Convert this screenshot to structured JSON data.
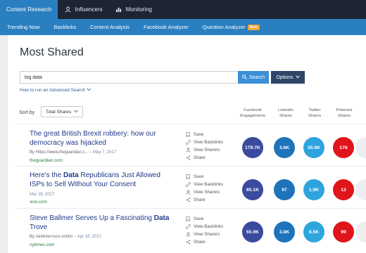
{
  "topnav": [
    {
      "label": "Content Research",
      "icon": "search-icon",
      "active": true
    },
    {
      "label": "Influencers",
      "icon": "user-icon",
      "active": false
    },
    {
      "label": "Monitoring",
      "icon": "bar-chart-icon",
      "active": false
    }
  ],
  "subnav": [
    {
      "label": "Trending Now"
    },
    {
      "label": "Backlinks"
    },
    {
      "label": "Content Analysis"
    },
    {
      "label": "Facebook Analyzer"
    },
    {
      "label": "Question Analyzer",
      "badge": "New"
    }
  ],
  "page_title": "Most Shared",
  "search": {
    "value": "big data",
    "button_label": "Search",
    "options_label": "Options"
  },
  "advanced_search_link": "How to run an Advanced Search",
  "sort": {
    "label": "Sort by",
    "selected": "Total Shares"
  },
  "columns": [
    {
      "line1": "Facebook",
      "line2": "Engagements"
    },
    {
      "line1": "LinkedIn",
      "line2": "Shares"
    },
    {
      "line1": "Twitter",
      "line2": "Shares"
    },
    {
      "line1": "Pinterest",
      "line2": "Shares"
    }
  ],
  "actions": [
    "Save",
    "View Backlinks",
    "View Sharers",
    "Share"
  ],
  "articles": [
    {
      "title_line1": "The great British Brexit robbery: how our",
      "title_line2": "democracy was hijacked",
      "author": "By Https://www.theguardian.c...",
      "date": "May 7, 2017",
      "domain": "theguardian.com",
      "facebook": "179.7K",
      "linkedin": "3.6K",
      "twitter": "35.9K",
      "pinterest": "176"
    },
    {
      "title_a": "Here's the ",
      "title_bold": "Data",
      "title_b": " Republicans Just Allowed",
      "title_line2": "ISPs to Sell Without Your Consent",
      "author": "",
      "date": "Mar 28, 2017",
      "domain": "vice.com",
      "facebook": "85.1K",
      "linkedin": "97",
      "twitter": "1.9K",
      "pinterest": "13"
    },
    {
      "title_a": "Steve Ballmer Serves Up a Fascinating ",
      "title_bold": "Data",
      "title_line2": "Trove",
      "author": "By /andrew-ross-sorkin",
      "date": "Apr 18, 2017",
      "domain": "nytimes.com",
      "facebook": "55.9K",
      "linkedin": "3.8K",
      "twitter": "8.5K",
      "pinterest": "99"
    }
  ],
  "colors": {
    "facebook": "#3a4a9e",
    "linkedin": "#1e73bb",
    "twitter": "#2ea4de",
    "pinterest": "#e0151b",
    "nav_dark": "#1d2433",
    "nav_blue": "#2a7fc0"
  }
}
